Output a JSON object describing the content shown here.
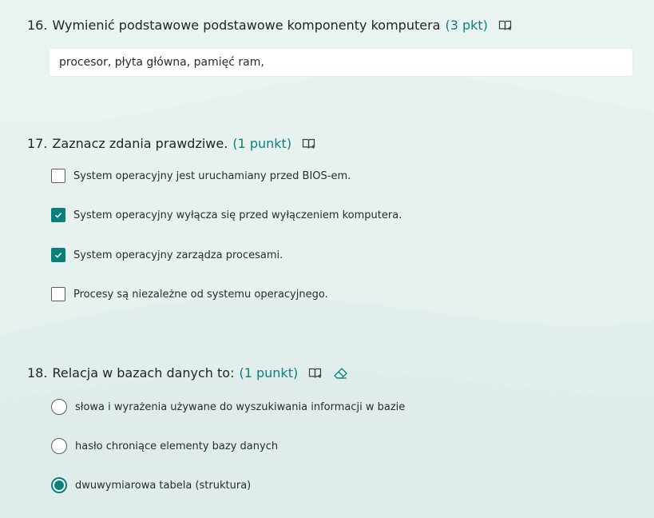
{
  "colors": {
    "accent": "#0b7f7a",
    "background": "#e6f1f0",
    "answer_box": "#ffffff"
  },
  "questions": [
    {
      "number": "16.",
      "text": "Wymienić podstawowe podstawowe komponenty komputera",
      "points": "(3 pkt)",
      "icons": [
        "immersive-reader-icon"
      ],
      "answer": "procesor, płyta główna, pamięć ram,"
    },
    {
      "number": "17.",
      "text": "Zaznacz zdania prawdziwe.",
      "points": "(1 punkt)",
      "icons": [
        "immersive-reader-icon"
      ],
      "options": [
        {
          "label": "System operacyjny jest uruchamiany przed BIOS-em.",
          "checked": false
        },
        {
          "label": "System operacyjny wyłącza się przed wyłączeniem komputera.",
          "checked": true
        },
        {
          "label": "System operacyjny zarządza procesami.",
          "checked": true
        },
        {
          "label": "Procesy są niezależne od systemu operacyjnego.",
          "checked": false
        }
      ]
    },
    {
      "number": "18.",
      "text": "Relacja w bazach danych to:",
      "points": "(1 punkt)",
      "icons": [
        "immersive-reader-icon",
        "eraser-icon"
      ],
      "options": [
        {
          "label": "słowa i wyrażenia używane do wyszukiwania informacji w bazie",
          "selected": false
        },
        {
          "label": "hasło chroniące elementy bazy danych",
          "selected": false
        },
        {
          "label": "dwuwymiarowa tabela (struktura)",
          "selected": true
        }
      ]
    }
  ]
}
